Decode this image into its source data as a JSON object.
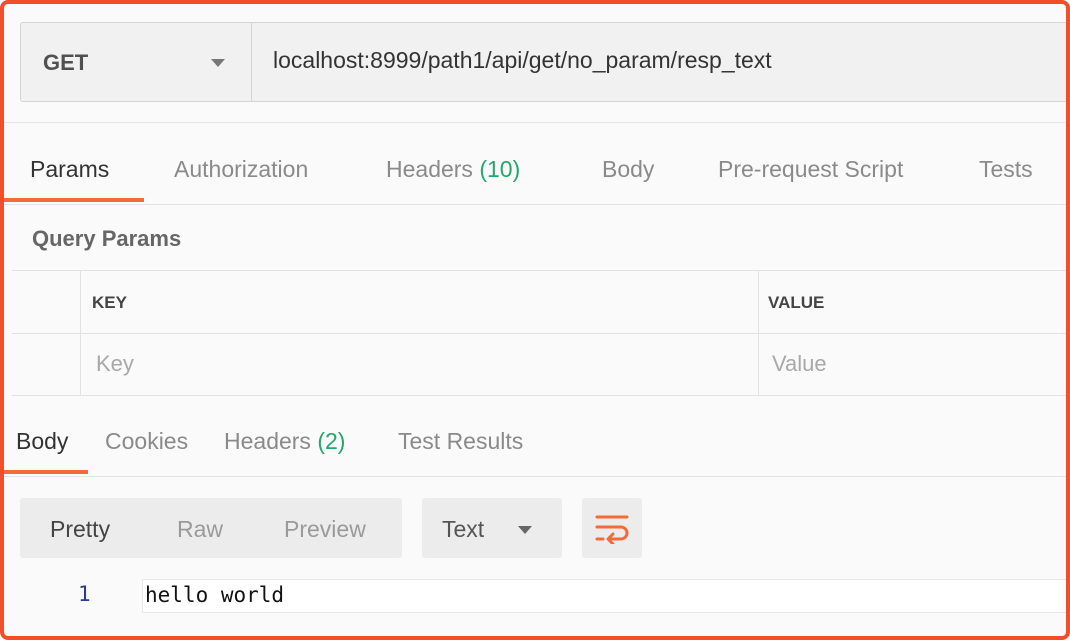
{
  "request": {
    "method": "GET",
    "url": "localhost:8999/path1/api/get/no_param/resp_text"
  },
  "request_tabs": {
    "params": "Params",
    "authorization": "Authorization",
    "headers": "Headers",
    "headers_count": "(10)",
    "body": "Body",
    "prerequest": "Pre-request Script",
    "tests": "Tests"
  },
  "query_params": {
    "title": "Query Params",
    "key_header": "KEY",
    "value_header": "VALUE",
    "key_placeholder": "Key",
    "value_placeholder": "Value"
  },
  "response_tabs": {
    "body": "Body",
    "cookies": "Cookies",
    "headers": "Headers",
    "headers_count": "(2)",
    "test_results": "Test Results"
  },
  "response_toolbar": {
    "pretty": "Pretty",
    "raw": "Raw",
    "preview": "Preview",
    "type": "Text",
    "wrap_icon": "wrap-lines-icon"
  },
  "response_body": {
    "line_number": "1",
    "text": "hello world"
  },
  "colors": {
    "accent": "#f26b3a",
    "frame_border": "#f24e2a",
    "count_green": "#26a56e"
  }
}
